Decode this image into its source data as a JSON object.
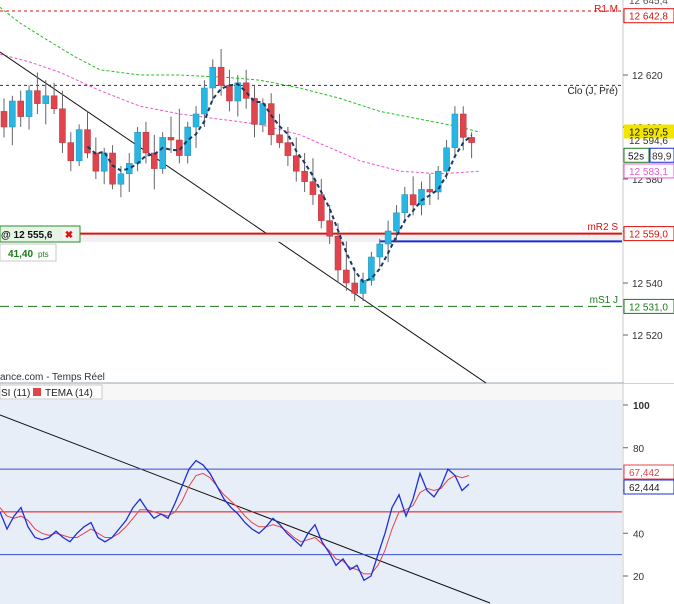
{
  "colors": {
    "up": "#29b6e3",
    "down": "#e0444d",
    "axis_bg": "#ffffff",
    "rsi_bg": "#e8eef8",
    "rsi_line": "#1f2fd6",
    "tema_line": "#e0444d",
    "pivot_red": "#e01010",
    "pivot_green": "#1b7a1b",
    "blue_level": "#1f2bd6",
    "ma_green": "#22c222",
    "ma_pink": "#e85ad0",
    "trend_black": "#111111",
    "dashed_navy": "#143a66"
  },
  "price_axis": {
    "ticks": [
      "12 620",
      "12 600",
      "12 580",
      "12 560",
      "12 540",
      "12 520"
    ],
    "labels": [
      {
        "id": "r1m",
        "text": "12 642,8",
        "value": 12642.8,
        "color": "#e01010",
        "style": "boxed-red"
      },
      {
        "id": "last",
        "text": "12 597,5",
        "value": 12597.5,
        "color": "#f2e600",
        "style": "filled-yellow"
      },
      {
        "id": "ma1",
        "text": "12 594,6",
        "value": 12594.6,
        "color": "#5a5a5a",
        "style": "plain"
      },
      {
        "id": "timer",
        "text": "52s",
        "value": 12589.9,
        "color": "#1b7a1b",
        "style": "timer"
      },
      {
        "id": "ma2",
        "text": "89,9",
        "value": 12589.9,
        "color": "#1f2bd6",
        "style": "plain"
      },
      {
        "id": "ma3",
        "text": "12 583,1",
        "value": 12583.1,
        "color": "#e85ad0",
        "style": "boxed-pink"
      },
      {
        "id": "mr2",
        "text": "12 559,0",
        "value": 12559.0,
        "color": "#e01010",
        "style": "boxed-red"
      },
      {
        "id": "ms1",
        "text": "12 531,0",
        "value": 12531.0,
        "color": "#1b7a1b",
        "style": "boxed-green"
      }
    ],
    "top_partial": "12 645,4"
  },
  "pivots": {
    "r1m": {
      "label": "R1 M",
      "value": 12644.6
    },
    "clo": {
      "label": "Clo (J, Pré)",
      "value": 12616.0
    },
    "mr2": {
      "label": "mR2 S",
      "value": 12559.0
    },
    "ms1": {
      "label": "mS1 J",
      "value": 12531.0
    },
    "blue": {
      "value": 12556.0
    }
  },
  "order": {
    "price": "@ 12 555,6",
    "close": "✖",
    "pts": "41,40",
    "pts_unit": "pts"
  },
  "source": "ance.com - Temps Réel",
  "legend": [
    {
      "label": "SI (11)",
      "color": "#1f2fd6"
    },
    {
      "label": "TEMA (14)",
      "color": "#e0444d"
    }
  ],
  "rsi_axis": {
    "ticks": [
      "100",
      "80",
      "60",
      "40",
      "20"
    ],
    "labels": [
      {
        "text": "67,442",
        "value": 67.4,
        "color": "#e0444d"
      },
      {
        "text": "62,444",
        "value": 62.4,
        "color": "#1f2fd6"
      }
    ]
  },
  "chart_data": {
    "type": "candlestick",
    "ylim": [
      12511,
      12649
    ],
    "candles": [
      [
        12606,
        12611,
        12596,
        12600
      ],
      [
        12600,
        12612,
        12593,
        12610
      ],
      [
        12610,
        12614,
        12600,
        12604
      ],
      [
        12604,
        12616,
        12599,
        12614
      ],
      [
        12614,
        12621,
        12605,
        12609
      ],
      [
        12609,
        12618,
        12601,
        12612
      ],
      [
        12612,
        12617,
        12605,
        12607
      ],
      [
        12607,
        12614,
        12590,
        12594
      ],
      [
        12594,
        12598,
        12583,
        12587
      ],
      [
        12587,
        12601,
        12585,
        12599
      ],
      [
        12599,
        12606,
        12588,
        12590
      ],
      [
        12590,
        12596,
        12580,
        12583
      ],
      [
        12583,
        12592,
        12578,
        12590
      ],
      [
        12590,
        12593,
        12576,
        12578
      ],
      [
        12578,
        12585,
        12573,
        12582
      ],
      [
        12582,
        12590,
        12575,
        12586
      ],
      [
        12586,
        12600,
        12583,
        12598
      ],
      [
        12598,
        12602,
        12586,
        12590
      ],
      [
        12590,
        12597,
        12576,
        12584
      ],
      [
        12584,
        12598,
        12582,
        12596
      ],
      [
        12596,
        12604,
        12590,
        12595
      ],
      [
        12595,
        12607,
        12586,
        12589
      ],
      [
        12589,
        12602,
        12586,
        12600
      ],
      [
        12600,
        12608,
        12592,
        12605
      ],
      [
        12605,
        12618,
        12600,
        12615
      ],
      [
        12615,
        12626,
        12610,
        12623
      ],
      [
        12623,
        12630,
        12612,
        12616
      ],
      [
        12616,
        12622,
        12606,
        12610
      ],
      [
        12610,
        12620,
        12604,
        12617
      ],
      [
        12617,
        12622,
        12607,
        12611
      ],
      [
        12611,
        12616,
        12596,
        12601
      ],
      [
        12601,
        12611,
        12598,
        12609
      ],
      [
        12609,
        12613,
        12593,
        12597
      ],
      [
        12597,
        12605,
        12592,
        12594
      ],
      [
        12594,
        12600,
        12585,
        12589
      ],
      [
        12589,
        12596,
        12579,
        12583
      ],
      [
        12583,
        12590,
        12575,
        12579
      ],
      [
        12579,
        12588,
        12570,
        12574
      ],
      [
        12574,
        12580,
        12561,
        12564
      ],
      [
        12564,
        12570,
        12555,
        12558
      ],
      [
        12558,
        12563,
        12540,
        12545
      ],
      [
        12545,
        12556,
        12537,
        12540
      ],
      [
        12540,
        12546,
        12533,
        12536
      ],
      [
        12536,
        12544,
        12533,
        12541
      ],
      [
        12541,
        12552,
        12539,
        12550
      ],
      [
        12550,
        12557,
        12546,
        12555
      ],
      [
        12555,
        12564,
        12548,
        12560
      ],
      [
        12560,
        12570,
        12556,
        12567
      ],
      [
        12567,
        12577,
        12563,
        12574
      ],
      [
        12574,
        12581,
        12566,
        12570
      ],
      [
        12570,
        12579,
        12566,
        12576
      ],
      [
        12576,
        12582,
        12570,
        12575
      ],
      [
        12575,
        12585,
        12572,
        12583
      ],
      [
        12583,
        12595,
        12580,
        12592
      ],
      [
        12592,
        12608,
        12588,
        12605
      ],
      [
        12605,
        12608,
        12591,
        12596
      ],
      [
        12596,
        12598,
        12588,
        12594
      ]
    ],
    "ma_green": [
      [
        -20,
        12652
      ],
      [
        20,
        12640
      ],
      [
        45,
        12634
      ],
      [
        75,
        12627
      ],
      [
        100,
        12622
      ],
      [
        140,
        12620
      ],
      [
        180,
        12620
      ],
      [
        230,
        12619
      ],
      [
        260,
        12618
      ],
      [
        300,
        12615
      ],
      [
        340,
        12611
      ],
      [
        380,
        12606
      ],
      [
        420,
        12603
      ],
      [
        460,
        12600
      ],
      [
        480,
        12598
      ]
    ],
    "ma_pink": [
      [
        0,
        12628
      ],
      [
        30,
        12625
      ],
      [
        60,
        12621
      ],
      [
        100,
        12614
      ],
      [
        140,
        12608
      ],
      [
        180,
        12605
      ],
      [
        220,
        12603
      ],
      [
        260,
        12601
      ],
      [
        300,
        12597
      ],
      [
        330,
        12592
      ],
      [
        360,
        12587
      ],
      [
        400,
        12583
      ],
      [
        440,
        12582
      ],
      [
        480,
        12583
      ]
    ],
    "rsi": [
      50,
      42,
      48,
      52,
      43,
      38,
      37,
      38,
      41,
      38,
      36,
      40,
      43,
      45,
      38,
      36,
      38,
      42,
      46,
      52,
      56,
      51,
      47,
      49,
      47,
      54,
      62,
      70,
      74,
      72,
      68,
      62,
      56,
      52,
      49,
      45,
      42,
      40,
      43,
      47,
      44,
      40,
      37,
      34,
      40,
      44,
      36,
      31,
      25,
      28,
      23,
      25,
      18,
      20,
      30,
      40,
      52,
      58,
      48,
      56,
      68,
      60,
      57,
      62,
      70,
      67,
      60,
      63
    ],
    "tema": [
      52,
      48,
      47,
      48,
      46,
      42,
      40,
      39,
      40,
      39,
      38,
      38,
      40,
      42,
      40,
      38,
      38,
      40,
      43,
      47,
      51,
      51,
      50,
      49,
      48,
      50,
      55,
      62,
      67,
      68,
      66,
      62,
      58,
      55,
      52,
      48,
      45,
      43,
      43,
      44,
      43,
      41,
      38,
      36,
      37,
      38,
      35,
      32,
      28,
      27,
      24,
      23,
      21,
      21,
      25,
      32,
      42,
      50,
      51,
      53,
      59,
      61,
      60,
      61,
      65,
      67,
      66,
      67
    ],
    "rsi_levels": {
      "top": 70,
      "mid": 50,
      "low": 30
    }
  }
}
